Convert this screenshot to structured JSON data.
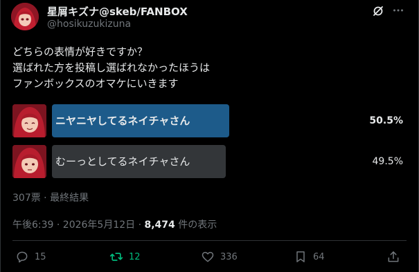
{
  "author": {
    "display_name": "星屑キズナ@skeb/FANBOX",
    "handle": "@hosikuzukizuna"
  },
  "tweet": {
    "lines": [
      "どちらの表情が好きですか？",
      "選ばれた方を投稿し選ばれなかったほうは",
      "ファンボックスのオマケにいきます"
    ]
  },
  "poll": {
    "options": [
      {
        "label": "ニヤニヤしてるネイチャさん",
        "percent_text": "50.5%",
        "percent": 50.5,
        "winner": true
      },
      {
        "label": "むーっとしてるネイチャさん",
        "percent_text": "49.5%",
        "percent": 49.5,
        "winner": false
      }
    ],
    "summary": "307票 · 最終結果"
  },
  "meta": {
    "time": "午後6:39 · 2026年5月12日 · ",
    "views_count": "8,474",
    "views_suffix": " 件の表示"
  },
  "actions": {
    "replies": "15",
    "retweets": "12",
    "likes": "336",
    "bookmarks": "64"
  },
  "colors": {
    "winner_bar": "#1d5b8a",
    "other_bar": "#333639",
    "retweet_green": "#00ba7c",
    "secondary_text": "#71767b"
  },
  "icons": {
    "grok": "grok-icon",
    "more": "more-icon",
    "reply": "reply-icon",
    "retweet": "retweet-icon",
    "like": "heart-icon",
    "bookmark": "bookmark-icon",
    "share": "share-icon"
  }
}
